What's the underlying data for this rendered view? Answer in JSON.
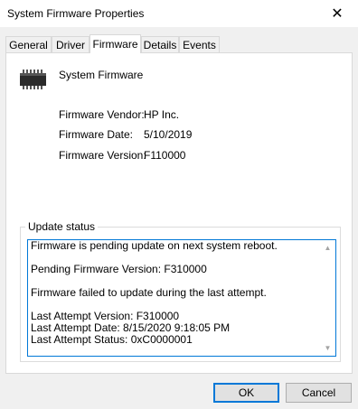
{
  "window": {
    "title": "System Firmware Properties",
    "close_glyph": "✕"
  },
  "tabs": [
    {
      "label": "General"
    },
    {
      "label": "Driver"
    },
    {
      "label": "Firmware",
      "active": true
    },
    {
      "label": "Details"
    },
    {
      "label": "Events"
    }
  ],
  "device": {
    "name": "System Firmware",
    "icon": "chip-icon"
  },
  "properties": {
    "vendor_label": "Firmware Vendor:",
    "vendor_value": "HP Inc.",
    "date_label": "Firmware Date:",
    "date_value": "5/10/2019",
    "version_label": "Firmware Version:",
    "version_value": "F110000"
  },
  "update_status": {
    "legend": "Update status",
    "text": "Firmware is pending update on next system reboot.\n\nPending Firmware Version: F310000\n\nFirmware failed to update during the last attempt.\n\nLast Attempt Version: F310000\nLast Attempt Date: 8/15/2020 9:18:05 PM\nLast Attempt Status: 0xC0000001"
  },
  "buttons": {
    "ok_label": "OK",
    "cancel_label": "Cancel"
  },
  "colors": {
    "accent": "#0078d7",
    "window_bg": "#f0f0f0"
  }
}
